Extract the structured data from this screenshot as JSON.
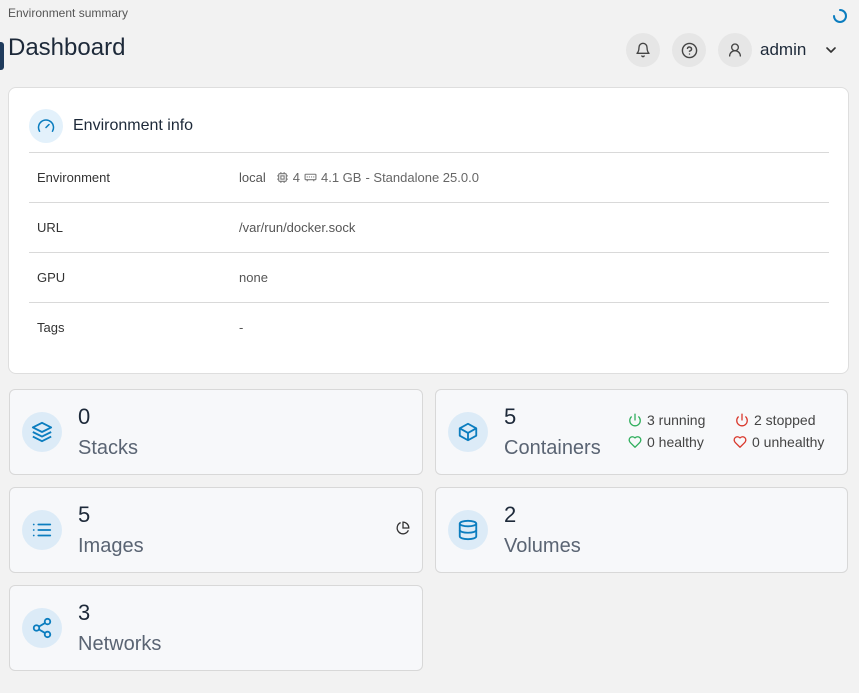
{
  "breadcrumb": "Environment summary",
  "page_title": "Dashboard",
  "header": {
    "user_name": "admin",
    "icons": [
      "bell-icon",
      "help-icon",
      "user-icon",
      "chevron-down-icon"
    ]
  },
  "env_info": {
    "title": "Environment info",
    "rows": [
      {
        "label": "Environment",
        "value": "local",
        "cpu": "4",
        "memory": "4.1 GB",
        "suffix": "- Standalone 25.0.0"
      },
      {
        "label": "URL",
        "value": "/var/run/docker.sock"
      },
      {
        "label": "GPU",
        "value": "none"
      },
      {
        "label": "Tags",
        "value": "-"
      }
    ]
  },
  "cards": {
    "stacks": {
      "count": "0",
      "label": "Stacks"
    },
    "containers": {
      "count": "5",
      "label": "Containers",
      "running": "3 running",
      "stopped": "2 stopped",
      "healthy": "0 healthy",
      "unhealthy": "0 unhealthy"
    },
    "images": {
      "count": "5",
      "label": "Images"
    },
    "volumes": {
      "count": "2",
      "label": "Volumes"
    },
    "networks": {
      "count": "3",
      "label": "Networks"
    }
  },
  "colors": {
    "accent": "#0b7dbf",
    "running": "#2fae5c",
    "stopped": "#d9382c",
    "icon_bg": "#dcebf7"
  }
}
